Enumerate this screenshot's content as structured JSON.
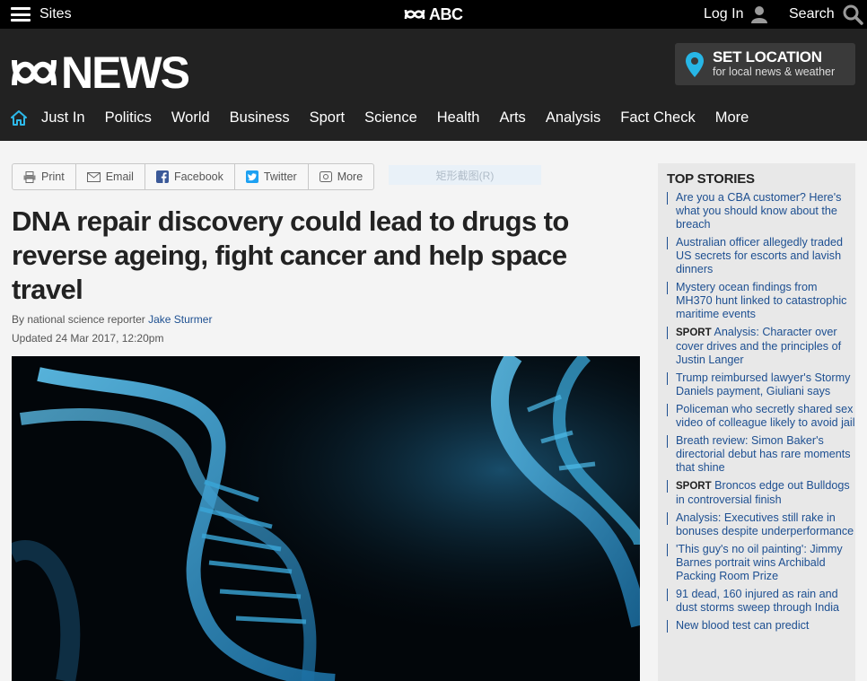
{
  "topbar": {
    "sites_label": "Sites",
    "abc_label": "ABC",
    "login_label": "Log In",
    "search_label": "Search"
  },
  "header": {
    "logo_text": "NEWS",
    "set_location": {
      "title": "SET LOCATION",
      "subtitle": "for local news & weather"
    }
  },
  "nav": {
    "items": [
      "Just In",
      "Politics",
      "World",
      "Business",
      "Sport",
      "Science",
      "Health",
      "Arts",
      "Analysis",
      "Fact Check",
      "More"
    ]
  },
  "share": {
    "print": "Print",
    "email": "Email",
    "facebook": "Facebook",
    "twitter": "Twitter",
    "more": "More"
  },
  "capture_overlay": "矩形截图(R)",
  "article": {
    "headline": "DNA repair discovery could lead to drugs to reverse ageing, fight cancer and help space travel",
    "byline_prefix": "By national science reporter ",
    "author": "Jake Sturmer",
    "updated": "Updated 24 Mar 2017, 12:20pm"
  },
  "sidebar": {
    "title": "TOP STORIES",
    "stories": [
      {
        "tag": "",
        "text": "Are you a CBA customer? Here's what you should know about the breach"
      },
      {
        "tag": "",
        "text": "Australian officer allegedly traded US secrets for escorts and lavish dinners"
      },
      {
        "tag": "",
        "text": "Mystery ocean findings from MH370 hunt linked to catastrophic maritime events"
      },
      {
        "tag": "SPORT",
        "text": "Analysis: Character over cover drives and the principles of Justin Langer"
      },
      {
        "tag": "",
        "text": "Trump reimbursed lawyer's Stormy Daniels payment, Giuliani says"
      },
      {
        "tag": "",
        "text": "Policeman who secretly shared sex video of colleague likely to avoid jail"
      },
      {
        "tag": "",
        "text": "Breath review: Simon Baker's directorial debut has rare moments that shine"
      },
      {
        "tag": "SPORT",
        "text": "Broncos edge out Bulldogs in controversial finish"
      },
      {
        "tag": "",
        "text": "Analysis: Executives still rake in bonuses despite underperformance"
      },
      {
        "tag": "",
        "text": "'This guy's no oil painting': Jimmy Barnes portrait wins Archibald Packing Room Prize"
      },
      {
        "tag": "",
        "text": "91 dead, 160 injured as rain and dust storms sweep through India"
      },
      {
        "tag": "",
        "text": "New blood test can predict"
      }
    ]
  },
  "colors": {
    "accent_blue": "#1d4f91",
    "nav_home_icon": "#2db8e8",
    "location_pin": "#27b6e6",
    "header_bg": "#222222"
  },
  "icons": [
    "hamburger-icon",
    "abc-logo-icon",
    "user-icon",
    "search-icon",
    "abc-news-logo",
    "location-pin-icon",
    "home-icon",
    "print-icon",
    "email-icon",
    "facebook-icon",
    "twitter-icon",
    "more-share-icon"
  ]
}
